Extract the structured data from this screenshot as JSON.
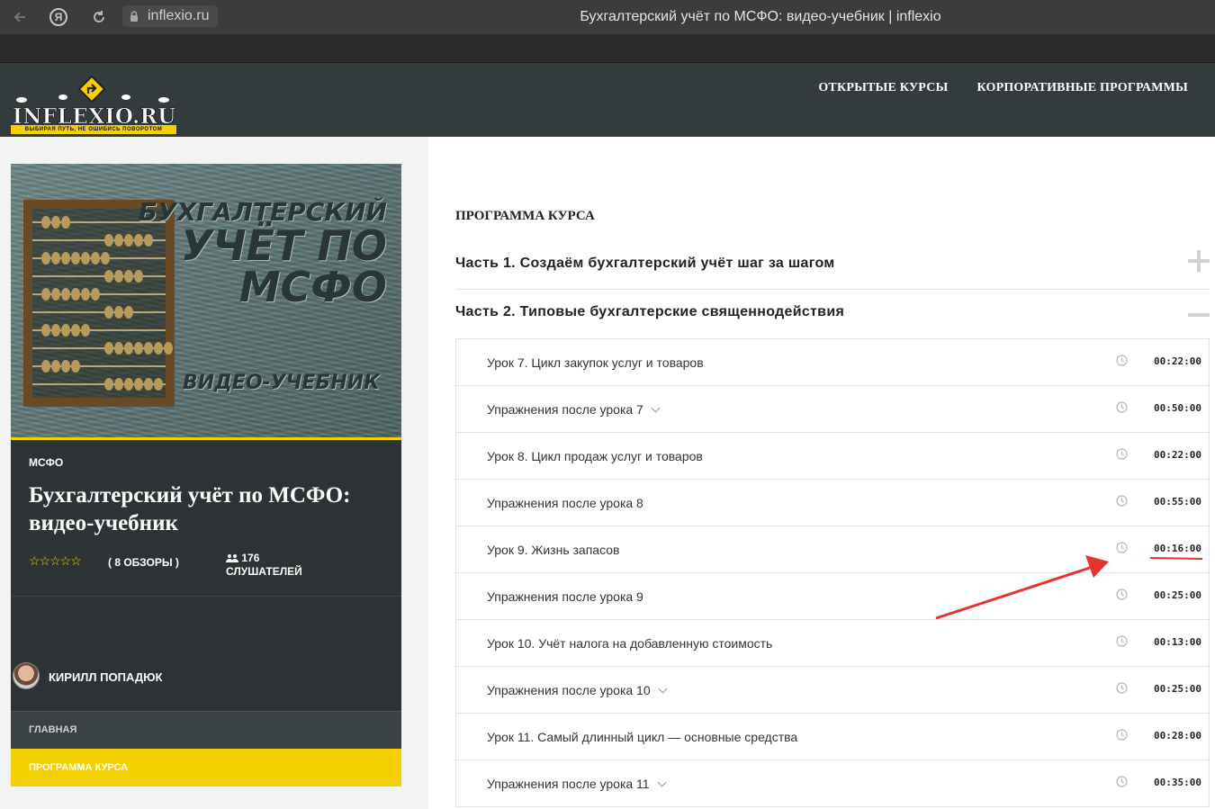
{
  "browser": {
    "url": "inflexio.ru",
    "tab_title": "Бухгалтерский учёт по МСФО: видео-учебник | inflexio",
    "yandex_label": "Я"
  },
  "header": {
    "logo_text": "INFLEXIO.RU",
    "logo_tagline": "ВЫБИРАЯ ПУТЬ, НЕ ОШИБИСЬ ПОВОРОТОМ",
    "nav": [
      "ОТКРЫТЫЕ КУРСЫ",
      "КОРПОРАТИВНЫЕ ПРОГРАММЫ"
    ]
  },
  "course": {
    "cover": {
      "line1": "БУХГАЛТЕРСКИЙ",
      "line2": "УЧЁТ ПО",
      "line3": "МСФО",
      "subtitle": "ВИДЕО-УЧЕБНИК"
    },
    "category": "МСФО",
    "title": "Бухгалтерский учёт по МСФО: видео-учебник",
    "reviews": "( 8 ОБЗОРЫ )",
    "rating_stars": 5,
    "listeners_count": "176",
    "listeners_label": "СЛУШАТЕЛЕЙ",
    "instructor": "КИРИЛЛ ПОПАДЮК",
    "menu": {
      "home": "ГЛАВНАЯ",
      "program": "ПРОГРАММА КУРСА"
    }
  },
  "curriculum": {
    "title": "ПРОГРАММА КУРСА",
    "sections": [
      {
        "label": "Часть 1. Создаём бухгалтерский учёт шаг за шагом",
        "state": "collapsed"
      },
      {
        "label": "Часть 2. Типовые бухгалтерские священнодействия",
        "state": "expanded"
      }
    ],
    "lessons": [
      {
        "title": "Урок 7. Цикл закупок услуг и товаров",
        "duration": "00:22:00",
        "expandable": false
      },
      {
        "title": "Упражнения после урока 7",
        "duration": "00:50:00",
        "expandable": true
      },
      {
        "title": "Урок 8. Цикл продаж услуг и товаров",
        "duration": "00:22:00",
        "expandable": false
      },
      {
        "title": "Упражнения после урока 8",
        "duration": "00:55:00",
        "expandable": false
      },
      {
        "title": "Урок 9. Жизнь запасов",
        "duration": "00:16:00",
        "expandable": false
      },
      {
        "title": "Упражнения после урока 9",
        "duration": "00:25:00",
        "expandable": false
      },
      {
        "title": "Урок 10. Учёт налога на добавленную стоимость",
        "duration": "00:13:00",
        "expandable": false
      },
      {
        "title": "Упражнения после урока 10",
        "duration": "00:25:00",
        "expandable": true
      },
      {
        "title": "Урок 11. Самый длинный цикл — основные средства",
        "duration": "00:28:00",
        "expandable": false
      },
      {
        "title": "Упражнения после урока 11",
        "duration": "00:35:00",
        "expandable": true
      }
    ]
  },
  "colors": {
    "accent_yellow": "#f5d000",
    "header_bg": "#333b3c",
    "annotation_red": "#e8322b"
  }
}
